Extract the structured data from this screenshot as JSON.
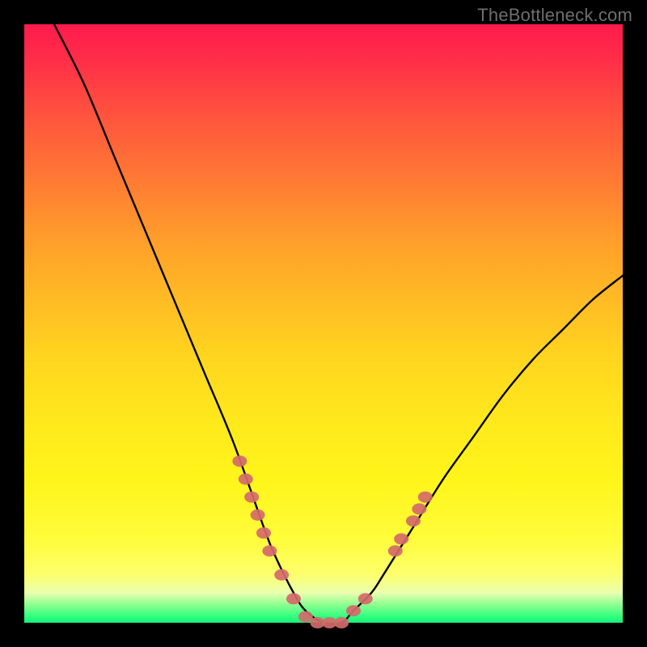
{
  "watermark": "TheBottleneck.com",
  "colors": {
    "frame": "#000000",
    "gradient_top": "#ff1a4d",
    "gradient_mid1": "#ff9e2a",
    "gradient_mid2": "#fff51a",
    "gradient_bottom": "#16f07a",
    "curve": "#000000",
    "markers": "#d46a6a"
  },
  "chart_data": {
    "type": "line",
    "title": "",
    "xlabel": "",
    "ylabel": "",
    "xlim": [
      0,
      100
    ],
    "ylim": [
      0,
      100
    ],
    "series": [
      {
        "name": "bottleneck-curve",
        "x": [
          5,
          10,
          15,
          20,
          25,
          30,
          35,
          40,
          42,
          45,
          47,
          50,
          53,
          55,
          58,
          60,
          65,
          70,
          75,
          80,
          85,
          90,
          95,
          100
        ],
        "y": [
          100,
          90,
          78,
          66,
          54,
          42,
          30,
          16,
          11,
          5,
          2,
          0,
          0,
          2,
          5,
          8,
          16,
          24,
          31,
          38,
          44,
          49,
          54,
          58
        ]
      }
    ],
    "markers": [
      {
        "x": 36,
        "y": 27
      },
      {
        "x": 37,
        "y": 24
      },
      {
        "x": 38,
        "y": 21
      },
      {
        "x": 39,
        "y": 18
      },
      {
        "x": 40,
        "y": 15
      },
      {
        "x": 41,
        "y": 12
      },
      {
        "x": 43,
        "y": 8
      },
      {
        "x": 45,
        "y": 4
      },
      {
        "x": 47,
        "y": 1
      },
      {
        "x": 49,
        "y": 0
      },
      {
        "x": 51,
        "y": 0
      },
      {
        "x": 53,
        "y": 0
      },
      {
        "x": 55,
        "y": 2
      },
      {
        "x": 57,
        "y": 4
      },
      {
        "x": 62,
        "y": 12
      },
      {
        "x": 63,
        "y": 14
      },
      {
        "x": 65,
        "y": 17
      },
      {
        "x": 66,
        "y": 19
      },
      {
        "x": 67,
        "y": 21
      }
    ],
    "annotations": []
  }
}
